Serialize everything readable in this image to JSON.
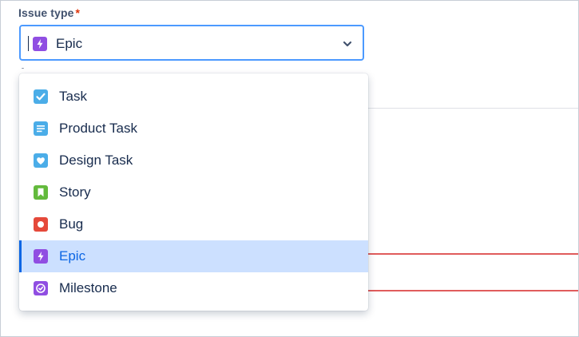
{
  "form": {
    "label": "Issue type",
    "required_marker": "*",
    "selected_value": "Epic"
  },
  "dropdown": {
    "items": [
      {
        "label": "Task",
        "icon": "task-checkbox-icon",
        "color": "#4bade8"
      },
      {
        "label": "Product Task",
        "icon": "product-task-icon",
        "color": "#4bade8"
      },
      {
        "label": "Design Task",
        "icon": "design-task-heart-icon",
        "color": "#4bade8"
      },
      {
        "label": "Story",
        "icon": "story-bookmark-icon",
        "color": "#63ba3c"
      },
      {
        "label": "Bug",
        "icon": "bug-dot-icon",
        "color": "#e5493a"
      },
      {
        "label": "Epic",
        "icon": "epic-lightning-icon",
        "color": "#904ee2",
        "selected": true
      },
      {
        "label": "Milestone",
        "icon": "milestone-check-icon",
        "color": "#904ee2"
      }
    ]
  },
  "colors": {
    "accent_blue": "#0c66e4",
    "focus_border": "#4c9aff",
    "selected_bg": "#cce0ff",
    "required_red": "#de350b",
    "text_dark": "#172b4d"
  }
}
